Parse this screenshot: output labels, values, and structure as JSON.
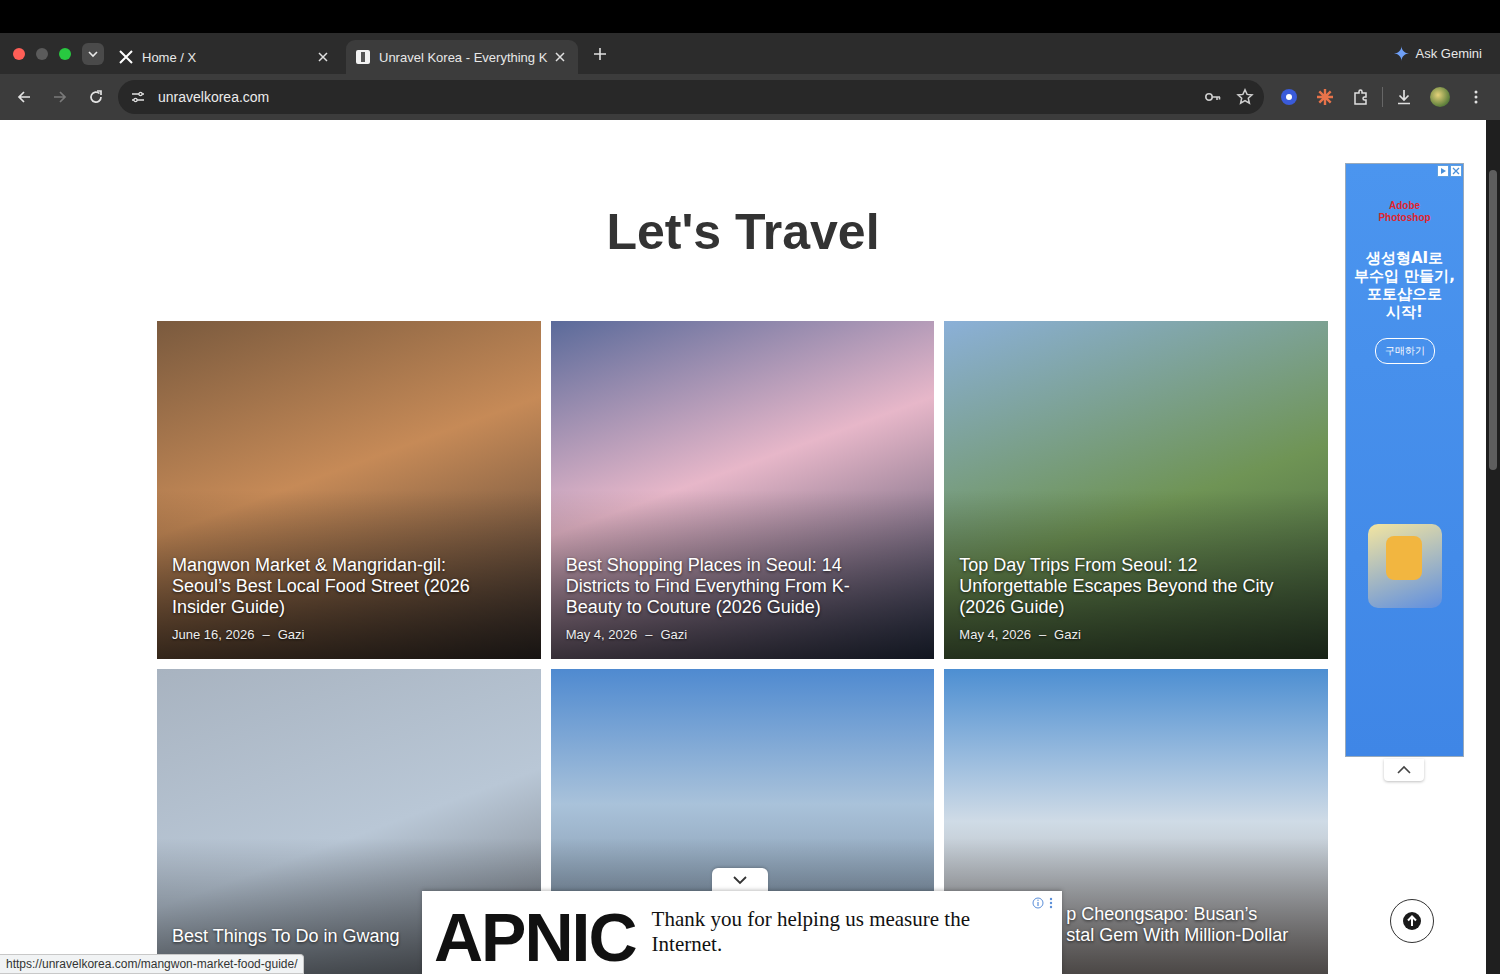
{
  "browser": {
    "tabs": [
      {
        "label": "Home / X",
        "selected": false
      },
      {
        "label": "Unravel Korea - Everything K",
        "selected": true
      }
    ],
    "gemini": "Ask Gemini",
    "url": "unravelkorea.com",
    "back_enabled": true,
    "forward_enabled": false,
    "status_url": "https://unravelkorea.com/mangwon-market-food-guide/"
  },
  "page": {
    "heading": "Let's Travel",
    "meta_separator": "–",
    "cards": [
      {
        "title_lines": [
          "Mangwon Market & Mangridan-gil:",
          "Seoul’s Best Local Food Street (2026",
          "Insider Guide)"
        ],
        "date": "June 16, 2026",
        "author": "Gazi"
      },
      {
        "title_lines": [
          "Best Shopping Places in Seoul: 14",
          "Districts to Find Everything From K-",
          "Beauty to Couture (2026 Guide)"
        ],
        "date": "May 4, 2026",
        "author": "Gazi"
      },
      {
        "title_lines": [
          "Top Day Trips From Seoul: 12",
          "Unforgettable Escapes Beyond the City",
          "(2026 Guide)"
        ],
        "date": "May 4, 2026",
        "author": "Gazi"
      },
      {
        "title_lines": [
          "Best Things To Do in Gwang"
        ],
        "date": "",
        "author": ""
      },
      {
        "title_lines": [],
        "date": "",
        "author": ""
      },
      {
        "title_lines": [
          "p Cheongsapo: Busan’s",
          "stal Gem With Million-Dollar"
        ],
        "date": "",
        "author": ""
      }
    ]
  },
  "side_ad": {
    "brand_top": "Adobe",
    "brand": "Photoshop",
    "headline_lines": [
      "생성형AI로",
      "부수입 만들기,",
      "포토샵으로",
      "시작!"
    ],
    "button": "구매하기"
  },
  "bottom_ad": {
    "logo": "APNIC",
    "message": "Thank you for helping us measure the Internet."
  }
}
